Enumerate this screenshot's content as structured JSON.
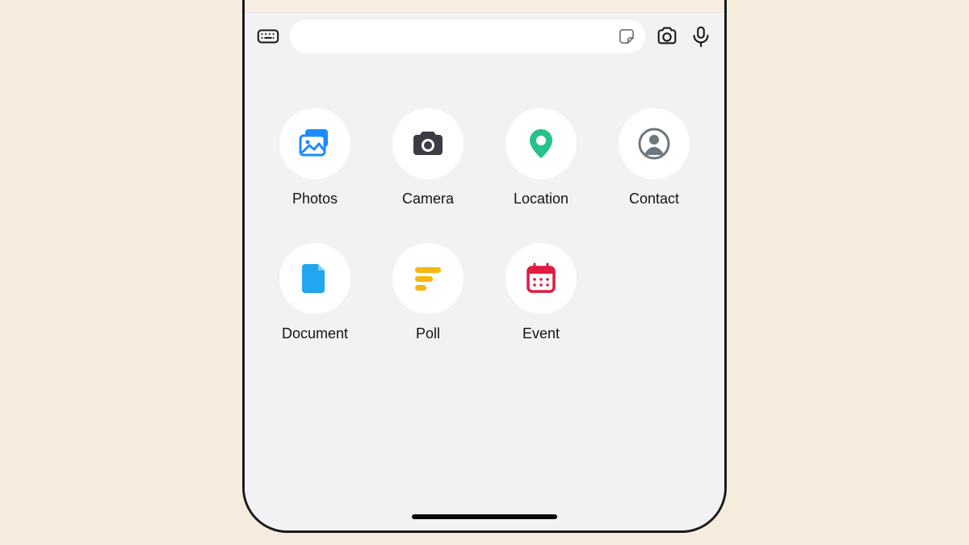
{
  "input": {
    "placeholder": ""
  },
  "attachments": [
    {
      "id": "photos",
      "label": "Photos"
    },
    {
      "id": "camera",
      "label": "Camera"
    },
    {
      "id": "location",
      "label": "Location"
    },
    {
      "id": "contact",
      "label": "Contact"
    },
    {
      "id": "document",
      "label": "Document"
    },
    {
      "id": "poll",
      "label": "Poll"
    },
    {
      "id": "event",
      "label": "Event"
    }
  ],
  "colors": {
    "photos": "#1a8cff",
    "camera": "#3a3d44",
    "location": "#25c38a",
    "contact": "#6f767c",
    "document": "#21a6f0",
    "poll": "#f5b70f",
    "event": "#e11a3f"
  }
}
